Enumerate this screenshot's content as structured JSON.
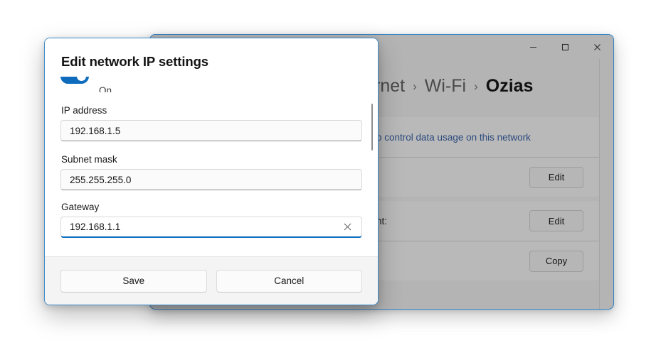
{
  "settings_window": {
    "titlebar": {
      "minimize_icon": "minimize-icon",
      "maximize_icon": "maximize-icon",
      "close_icon": "close-icon"
    },
    "breadcrumb": {
      "parent_truncated": "rnet",
      "separator": "›",
      "middle": "Wi-Fi",
      "current": "Ozias"
    },
    "rows": [
      {
        "text": "p control data usage on this network",
        "is_link": true,
        "action": ""
      },
      {
        "text": "",
        "is_link": false,
        "action": "Edit"
      },
      {
        "text": "nt:",
        "is_link": false,
        "action": "Edit"
      },
      {
        "text": "",
        "is_link": false,
        "action": "Copy"
      }
    ]
  },
  "dialog": {
    "title": "Edit network IP settings",
    "toggle": {
      "state_label": "On",
      "is_on": true
    },
    "fields": [
      {
        "label": "IP address",
        "value": "192.168.1.5",
        "focused": false,
        "clearable": false
      },
      {
        "label": "Subnet mask",
        "value": "255.255.255.0",
        "focused": false,
        "clearable": false
      },
      {
        "label": "Gateway",
        "value": "192.168.1.1",
        "focused": true,
        "clearable": true
      }
    ],
    "clear_icon": "clear-x-icon",
    "footer": {
      "save_label": "Save",
      "cancel_label": "Cancel"
    }
  },
  "colors": {
    "accent": "#0f6cbd",
    "window_border": "#2f82c8",
    "dialog_border": "#3b8ccc",
    "link": "#2b4a7e",
    "window_bg": "#b4b4b4",
    "card_bg": "#b9b9b9",
    "footer_bg": "#f4f4f4"
  }
}
